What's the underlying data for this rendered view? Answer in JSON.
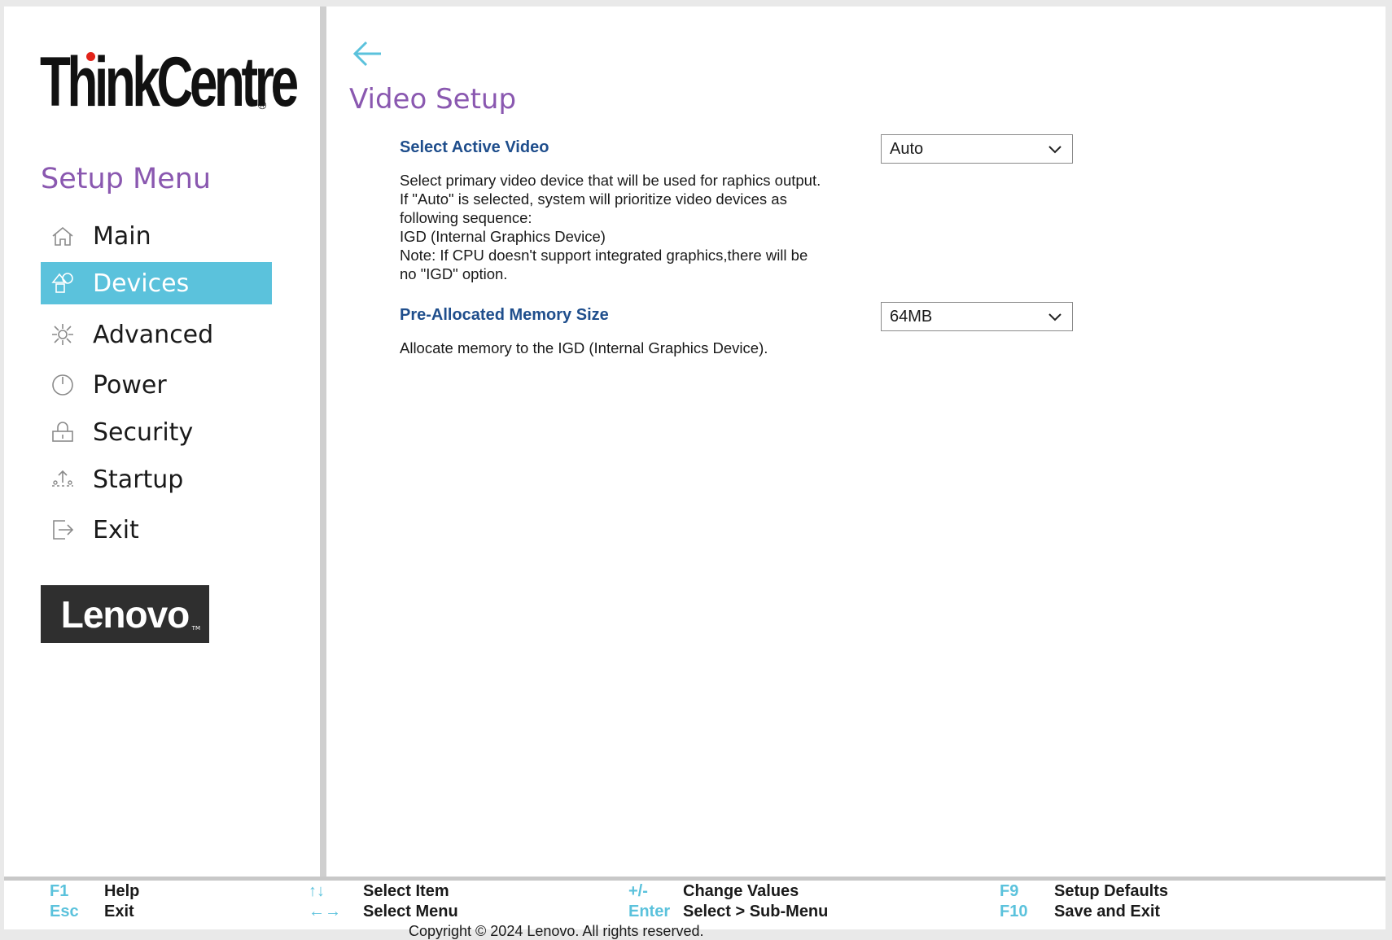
{
  "brand": {
    "logo_text": "ThinkCentre",
    "logo_reg": "®",
    "vendor_logo": "Lenovo",
    "vendor_tm": "TM"
  },
  "sidebar": {
    "title": "Setup Menu",
    "items": [
      {
        "label": "Main",
        "icon": "home-icon",
        "active": false
      },
      {
        "label": "Devices",
        "icon": "devices-icon",
        "active": true
      },
      {
        "label": "Advanced",
        "icon": "advanced-gear-icon",
        "active": false
      },
      {
        "label": "Power",
        "icon": "power-icon",
        "active": false
      },
      {
        "label": "Security",
        "icon": "lock-icon",
        "active": false
      },
      {
        "label": "Startup",
        "icon": "startup-icon",
        "active": false
      },
      {
        "label": "Exit",
        "icon": "exit-icon",
        "active": false
      }
    ]
  },
  "main": {
    "title": "Video Setup",
    "settings": [
      {
        "label": "Select Active Video",
        "value": "Auto",
        "description": [
          "Select primary video device that will be used for raphics output.",
          "If \"Auto\" is selected, system will prioritize video devices as",
          "following sequence:",
          "IGD (Internal Graphics Device)",
          "Note: If CPU doesn't support integrated graphics,there will be",
          "no \"IGD\" option."
        ]
      },
      {
        "label": "Pre-Allocated Memory Size",
        "value": "64MB",
        "description": [
          "Allocate memory to the IGD (Internal Graphics Device)."
        ]
      }
    ]
  },
  "footer": {
    "keys": [
      {
        "key": "F1",
        "desc": "Help"
      },
      {
        "key": "Esc",
        "desc": "Exit"
      },
      {
        "key": "↑↓",
        "desc": "Select Item"
      },
      {
        "key": "←→",
        "desc": "Select Menu"
      },
      {
        "key": "+/-",
        "desc": "Change Values"
      },
      {
        "key": "Enter",
        "desc": "Select > Sub-Menu"
      },
      {
        "key": "F9",
        "desc": "Setup Defaults"
      },
      {
        "key": "F10",
        "desc": "Save and Exit"
      }
    ],
    "copyright": "Copyright © 2024 Lenovo. All rights reserved."
  },
  "colors": {
    "accent": "#5bc2dc",
    "title_purple": "#8a58b0",
    "label_blue": "#1f4e8c"
  }
}
